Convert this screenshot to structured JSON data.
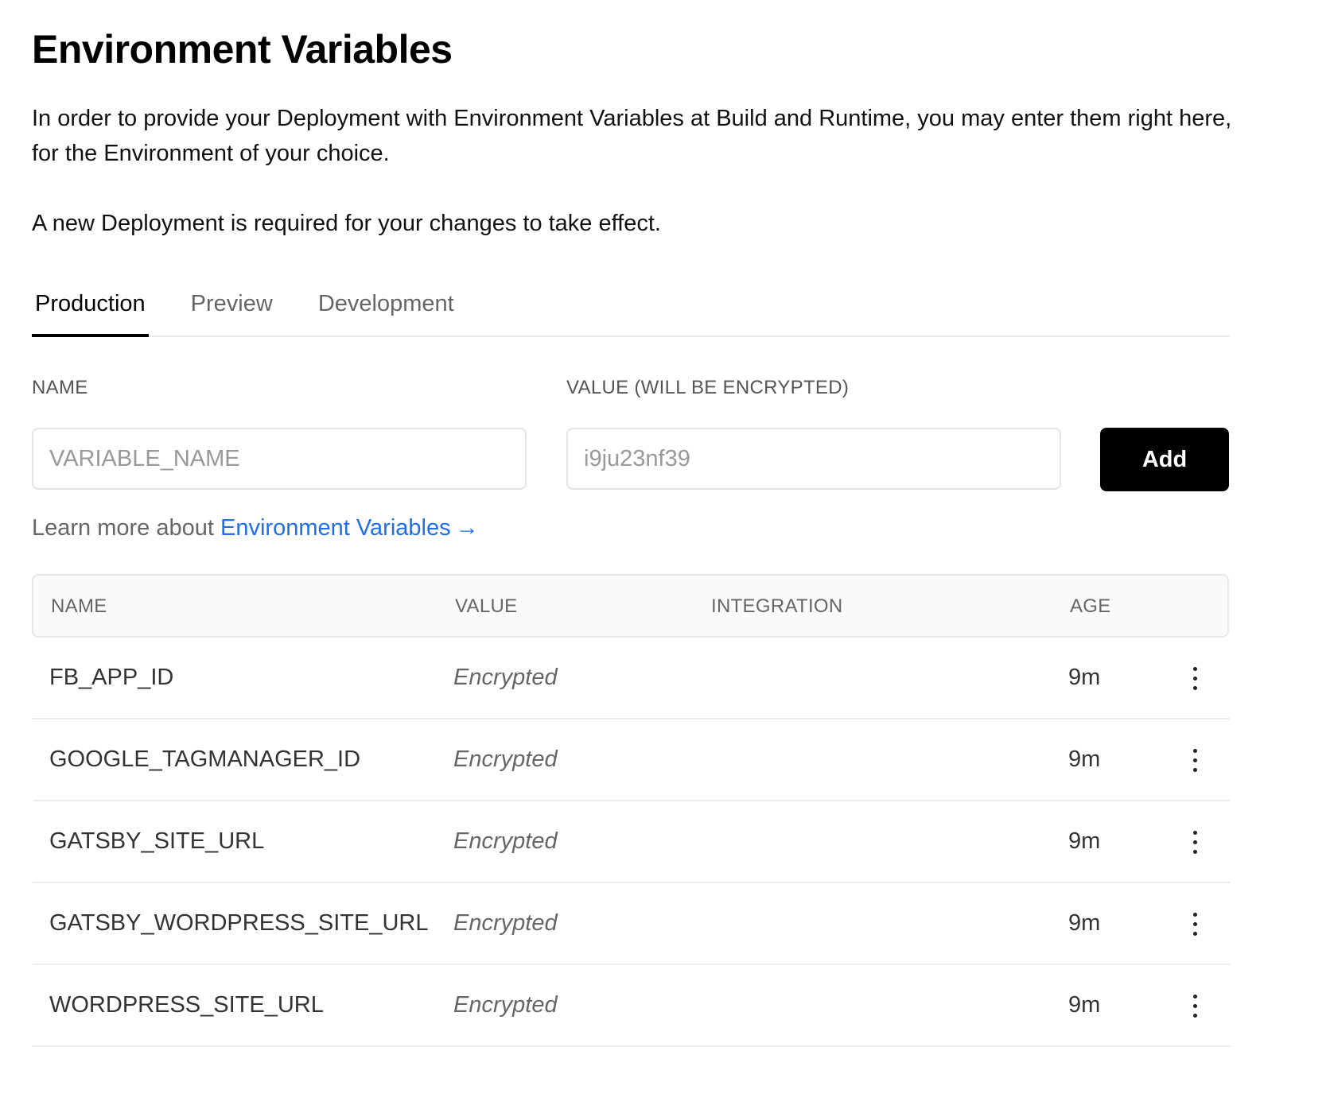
{
  "page": {
    "title": "Environment Variables",
    "intro": "In order to provide your Deployment with Environment Variables at Build and Runtime, you may enter them right here, for the Environment of your choice.",
    "notice": "A new Deployment is required for your changes to take effect."
  },
  "tabs": [
    {
      "label": "Production",
      "active": true
    },
    {
      "label": "Preview",
      "active": false
    },
    {
      "label": "Development",
      "active": false
    }
  ],
  "form": {
    "name_label": "NAME",
    "value_label": "VALUE (WILL BE ENCRYPTED)",
    "name_placeholder": "VARIABLE_NAME",
    "value_placeholder": "i9ju23nf39",
    "name_value": "",
    "value_value": "",
    "add_label": "Add"
  },
  "learn_more": {
    "prefix": "Learn more about",
    "link_text": "Environment Variables",
    "arrow": "→",
    "icon": "arrow-right-icon"
  },
  "table": {
    "columns": [
      "NAME",
      "VALUE",
      "INTEGRATION",
      "AGE"
    ],
    "rows": [
      {
        "name": "FB_APP_ID",
        "value": "Encrypted",
        "integration": "",
        "age": "9m"
      },
      {
        "name": "GOOGLE_TAGMANAGER_ID",
        "value": "Encrypted",
        "integration": "",
        "age": "9m"
      },
      {
        "name": "GATSBY_SITE_URL",
        "value": "Encrypted",
        "integration": "",
        "age": "9m"
      },
      {
        "name": "GATSBY_WORDPRESS_SITE_URL",
        "value": "Encrypted",
        "integration": "",
        "age": "9m"
      },
      {
        "name": "WORDPRESS_SITE_URL",
        "value": "Encrypted",
        "integration": "",
        "age": "9m"
      }
    ],
    "row_menu_icon": "more-vertical-icon"
  },
  "colors": {
    "accent": "#000000",
    "link": "#1f6feb",
    "muted_text": "#666666",
    "border": "#eaeaea"
  }
}
